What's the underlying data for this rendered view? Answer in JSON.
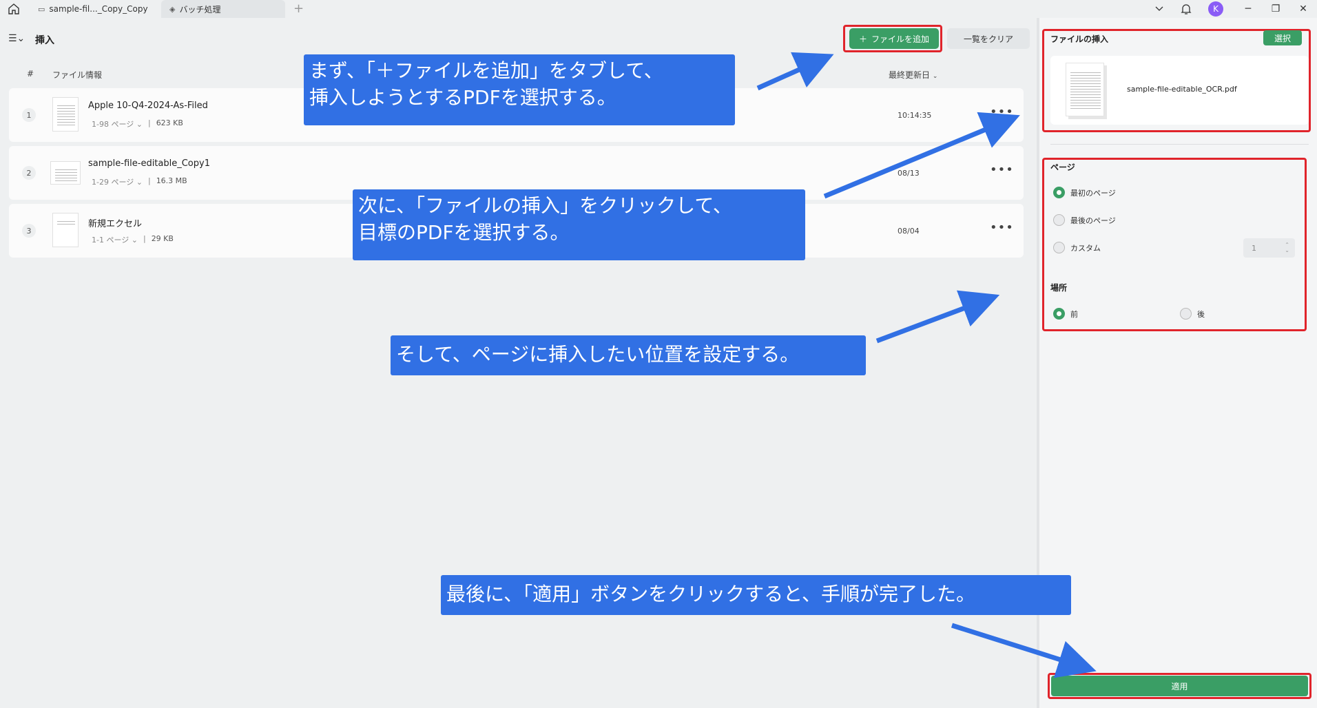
{
  "titlebar": {
    "tabs": [
      {
        "label": "sample-fil..._Copy_Copy"
      },
      {
        "label": "バッチ処理"
      }
    ],
    "add_tab": "+",
    "avatar_initial": "K"
  },
  "toolbar": {
    "title": "挿入",
    "add_file_label": "ファイルを追加",
    "clear_label": "一覧をクリア"
  },
  "table": {
    "col_num": "#",
    "col_info": "ファイル情報",
    "col_date": "最終更新日"
  },
  "files": [
    {
      "num": "1",
      "name": "Apple 10-Q4-2024-As-Filed",
      "pages": "1-98 ページ",
      "size": "623 KB",
      "date": "10:14:35"
    },
    {
      "num": "2",
      "name": "sample-file-editable_Copy1",
      "pages": "1-29 ページ",
      "size": "16.3 MB",
      "date": "08/13"
    },
    {
      "num": "3",
      "name": "新規エクセル",
      "pages": "1-1 ページ",
      "size": "29 KB",
      "date": "08/04"
    }
  ],
  "side": {
    "insert_title": "ファイルの挿入",
    "select_label": "選択",
    "insert_filename": "sample-file-editable_OCR.pdf",
    "page_label": "ページ",
    "page_opts": [
      "最初のページ",
      "最後のページ",
      "カスタム"
    ],
    "custom_value": "1",
    "position_label": "場所",
    "position_opts": [
      "前",
      "後"
    ],
    "apply_label": "適用"
  },
  "callouts": [
    "まず、「＋ファイルを追加」をタブして、\n挿入しようとするPDFを選択する。",
    "次に、「ファイルの挿入」をクリックして、\n目標のPDFを選択する。",
    "そして、ページに挿入したい位置を設定する。",
    "最後に、「適用」ボタンをクリックすると、手順が完了した。"
  ],
  "colors": {
    "accent": "#3a9e65",
    "highlight": "#e0242b",
    "callout": "#3170e4"
  }
}
